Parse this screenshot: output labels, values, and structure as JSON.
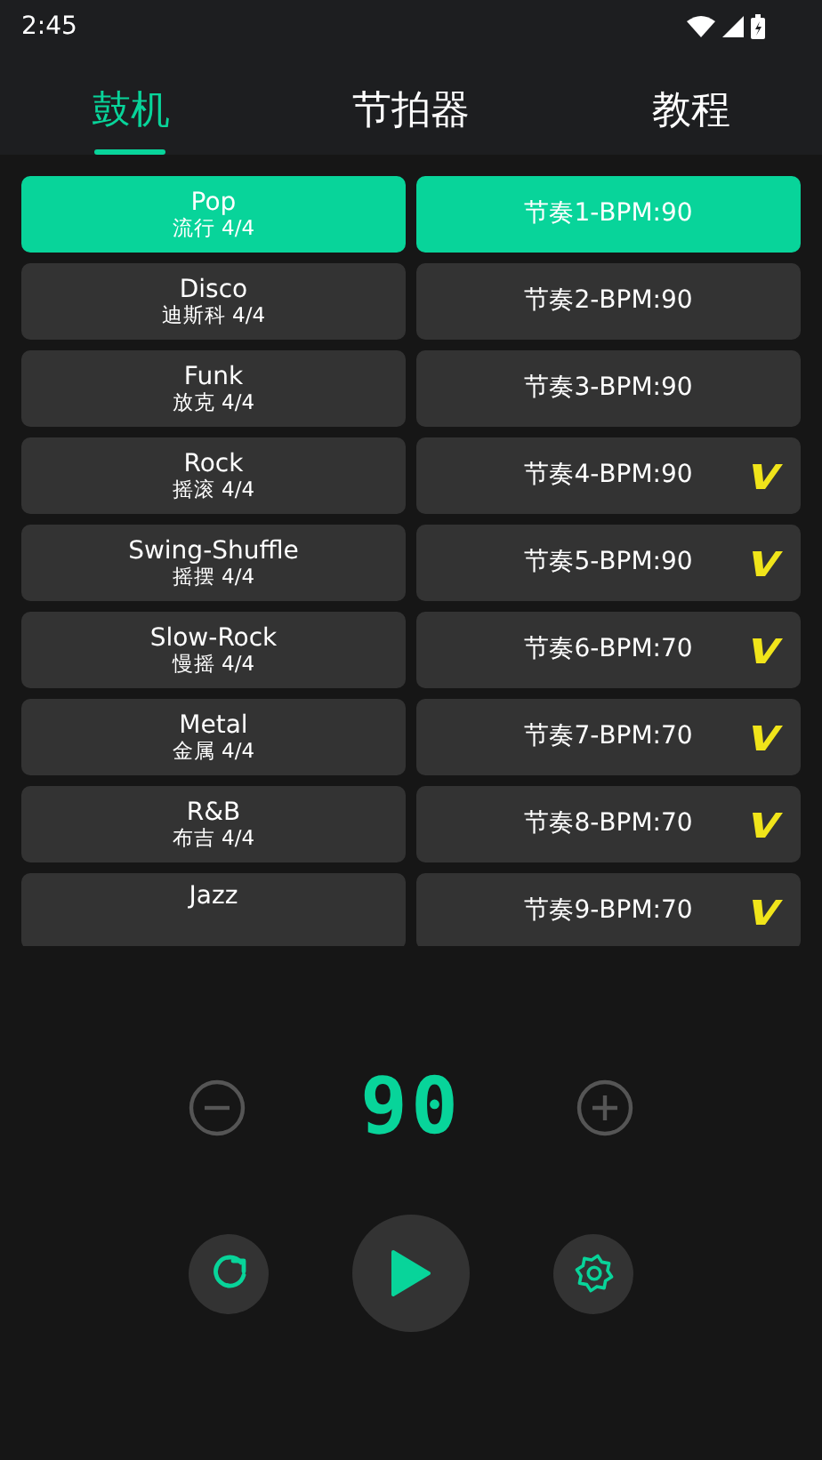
{
  "status_bar": {
    "time": "2:45"
  },
  "tabs": [
    {
      "label": "鼓机",
      "selected": true
    },
    {
      "label": "节拍器",
      "selected": false
    },
    {
      "label": "教程",
      "selected": false
    }
  ],
  "styles": [
    {
      "name": "Pop",
      "subtitle": "流行 4/4",
      "selected": true
    },
    {
      "name": "Disco",
      "subtitle": "迪斯科 4/4",
      "selected": false
    },
    {
      "name": "Funk",
      "subtitle": "放克 4/4",
      "selected": false
    },
    {
      "name": "Rock",
      "subtitle": "摇滚 4/4",
      "selected": false
    },
    {
      "name": "Swing-Shuffle",
      "subtitle": "摇摆 4/4",
      "selected": false
    },
    {
      "name": "Slow-Rock",
      "subtitle": "慢摇 4/4",
      "selected": false
    },
    {
      "name": "Metal",
      "subtitle": "金属 4/4",
      "selected": false
    },
    {
      "name": "R&B",
      "subtitle": "布吉 4/4",
      "selected": false
    },
    {
      "name": "Jazz",
      "selected": false
    }
  ],
  "rhythms": [
    {
      "label": "节奏1-BPM:90",
      "selected": true,
      "marked": false
    },
    {
      "label": "节奏2-BPM:90",
      "selected": false,
      "marked": false
    },
    {
      "label": "节奏3-BPM:90",
      "selected": false,
      "marked": false
    },
    {
      "label": "节奏4-BPM:90",
      "selected": false,
      "marked": true
    },
    {
      "label": "节奏5-BPM:90",
      "selected": false,
      "marked": true
    },
    {
      "label": "节奏6-BPM:70",
      "selected": false,
      "marked": true
    },
    {
      "label": "节奏7-BPM:70",
      "selected": false,
      "marked": true
    },
    {
      "label": "节奏8-BPM:70",
      "selected": false,
      "marked": true
    },
    {
      "label": "节奏9-BPM:70",
      "selected": false,
      "marked": true
    }
  ],
  "tempo": "90"
}
